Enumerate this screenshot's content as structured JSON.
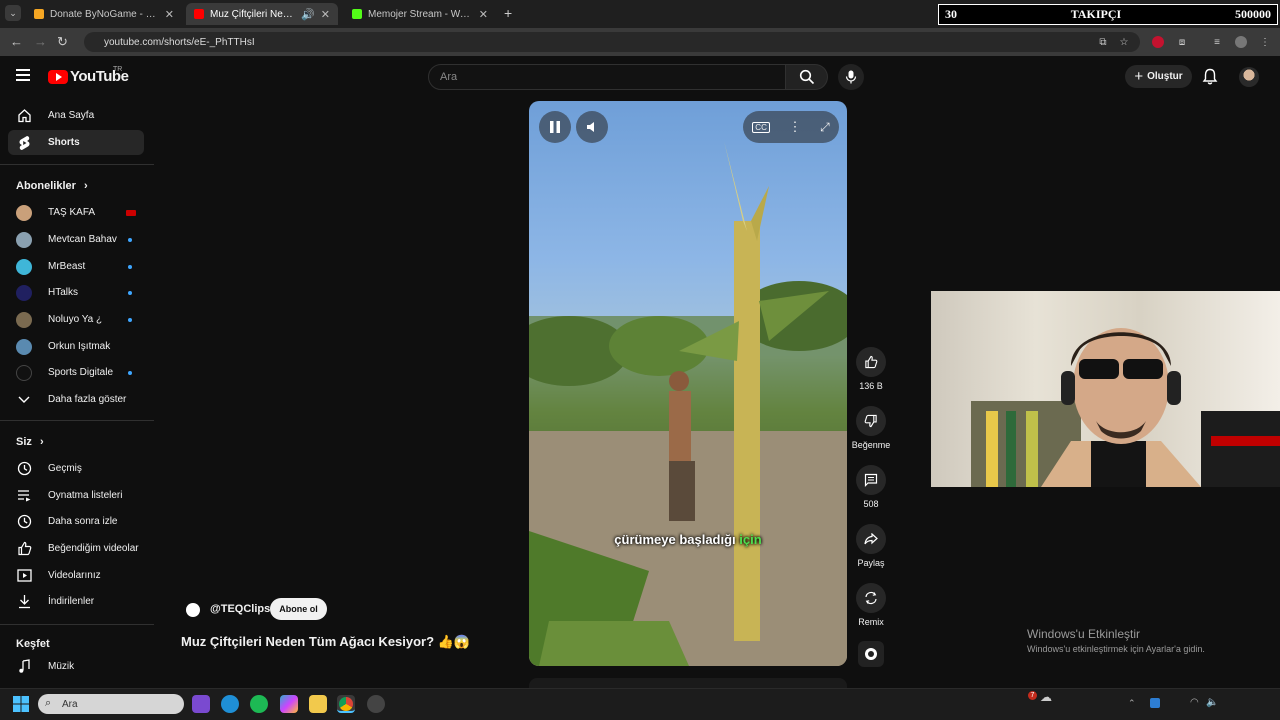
{
  "browser": {
    "tabs": [
      {
        "title": "Donate ByNoGame - Streamer",
        "favicon_color": "#f5a623"
      },
      {
        "title": "Muz Çiftçileri Neden Tüm Ağ",
        "favicon_color": "#ff0000"
      },
      {
        "title": "Memojer Stream - Watch Live",
        "favicon_color": "#53fc18"
      }
    ],
    "new_tab": "+",
    "url": "youtube.com/shorts/eE-_PhTTHsI"
  },
  "overlay": {
    "follower_current": "30",
    "follower_label": "TAKIPÇI",
    "follower_goal": "500000"
  },
  "header": {
    "logo_text": "YouTube",
    "logo_region": "TR",
    "search_placeholder": "Ara",
    "create_label": "Oluştur"
  },
  "sidebar": {
    "main": [
      {
        "label": "Ana Sayfa",
        "icon": "home-icon"
      },
      {
        "label": "Shorts",
        "icon": "shorts-icon"
      }
    ],
    "subscriptions_title": "Abonelikler",
    "subscriptions": [
      {
        "label": "TAŞ KAFA",
        "color": "#c9a07a",
        "live": true
      },
      {
        "label": "Mevtcan Bahav",
        "color": "#8aa0b0",
        "dot": true
      },
      {
        "label": "MrBeast",
        "color": "#3fb6d8",
        "dot": true
      },
      {
        "label": "HTalks",
        "color": "#202060",
        "dot": true
      },
      {
        "label": "Noluyo Ya ¿",
        "color": "#7a6a50",
        "dot": true
      },
      {
        "label": "Orkun Işıtmak",
        "color": "#5a8ab0",
        "dot": false
      },
      {
        "label": "Sports Digitale",
        "color": "#111111",
        "dot": true
      }
    ],
    "show_more": "Daha fazla göster",
    "you_title": "Siz",
    "you": [
      {
        "label": "Geçmiş",
        "icon": "history-icon"
      },
      {
        "label": "Oynatma listeleri",
        "icon": "playlists-icon"
      },
      {
        "label": "Daha sonra izle",
        "icon": "watch-later-icon"
      },
      {
        "label": "Beğendiğim videolar",
        "icon": "liked-icon"
      },
      {
        "label": "Videolarınız",
        "icon": "your-videos-icon"
      },
      {
        "label": "İndirilenler",
        "icon": "downloads-icon"
      }
    ],
    "explore_title": "Keşfet",
    "explore": [
      {
        "label": "Müzik",
        "icon": "music-icon"
      }
    ]
  },
  "short": {
    "subtitle_pre": "çürümeye başladığı",
    "subtitle_hl": "için",
    "channel": "@TEQClips",
    "subscribe": "Abone ol",
    "title": "Muz Çiftçileri Neden Tüm Ağacı Kesiyor? 👍😱",
    "actions": {
      "likes": "136 B",
      "dislike": "Beğenme",
      "comments": "508",
      "share": "Paylaş",
      "remix": "Remix"
    }
  },
  "windows": {
    "activate_title": "Windows'u Etkinleştir",
    "activate_sub": "Windows'u etkinleştirmek için Ayarlar'a gidin.",
    "taskbar_search": "Ara",
    "notification_count": "7"
  }
}
